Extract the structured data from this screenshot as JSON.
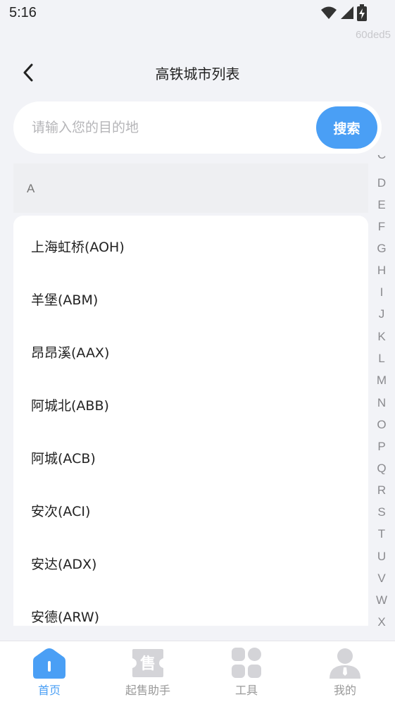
{
  "status_bar": {
    "time": "5:16",
    "icons": [
      "wifi-icon",
      "signal-icon",
      "battery-charging-icon"
    ]
  },
  "watermark": "60ded5",
  "header": {
    "title": "高铁城市列表",
    "back_icon": "chevron-left-icon"
  },
  "search": {
    "placeholder": "请输入您的目的地",
    "value": "",
    "button_label": "搜索"
  },
  "section": {
    "letter": "A"
  },
  "cities": [
    "上海虹桥(AOH)",
    "羊堡(ABM)",
    "昂昂溪(AAX)",
    "阿城北(ABB)",
    "阿城(ACB)",
    "安次(ACI)",
    "安达(ADX)",
    "安德(ARW)"
  ],
  "index_letters": [
    "C",
    "D",
    "E",
    "F",
    "G",
    "H",
    "I",
    "J",
    "K",
    "L",
    "M",
    "N",
    "O",
    "P",
    "Q",
    "R",
    "S",
    "T",
    "U",
    "V",
    "W",
    "X"
  ],
  "bottom_nav": [
    {
      "label": "首页",
      "icon": "home-icon",
      "active": true
    },
    {
      "label": "起售助手",
      "icon": "ticket-sale-icon",
      "active": false
    },
    {
      "label": "工具",
      "icon": "grid-tools-icon",
      "active": false
    },
    {
      "label": "我的",
      "icon": "user-icon",
      "active": false
    }
  ],
  "colors": {
    "accent": "#4a9ff5",
    "background": "#f2f3f7",
    "inactive": "#d4d4d8"
  }
}
